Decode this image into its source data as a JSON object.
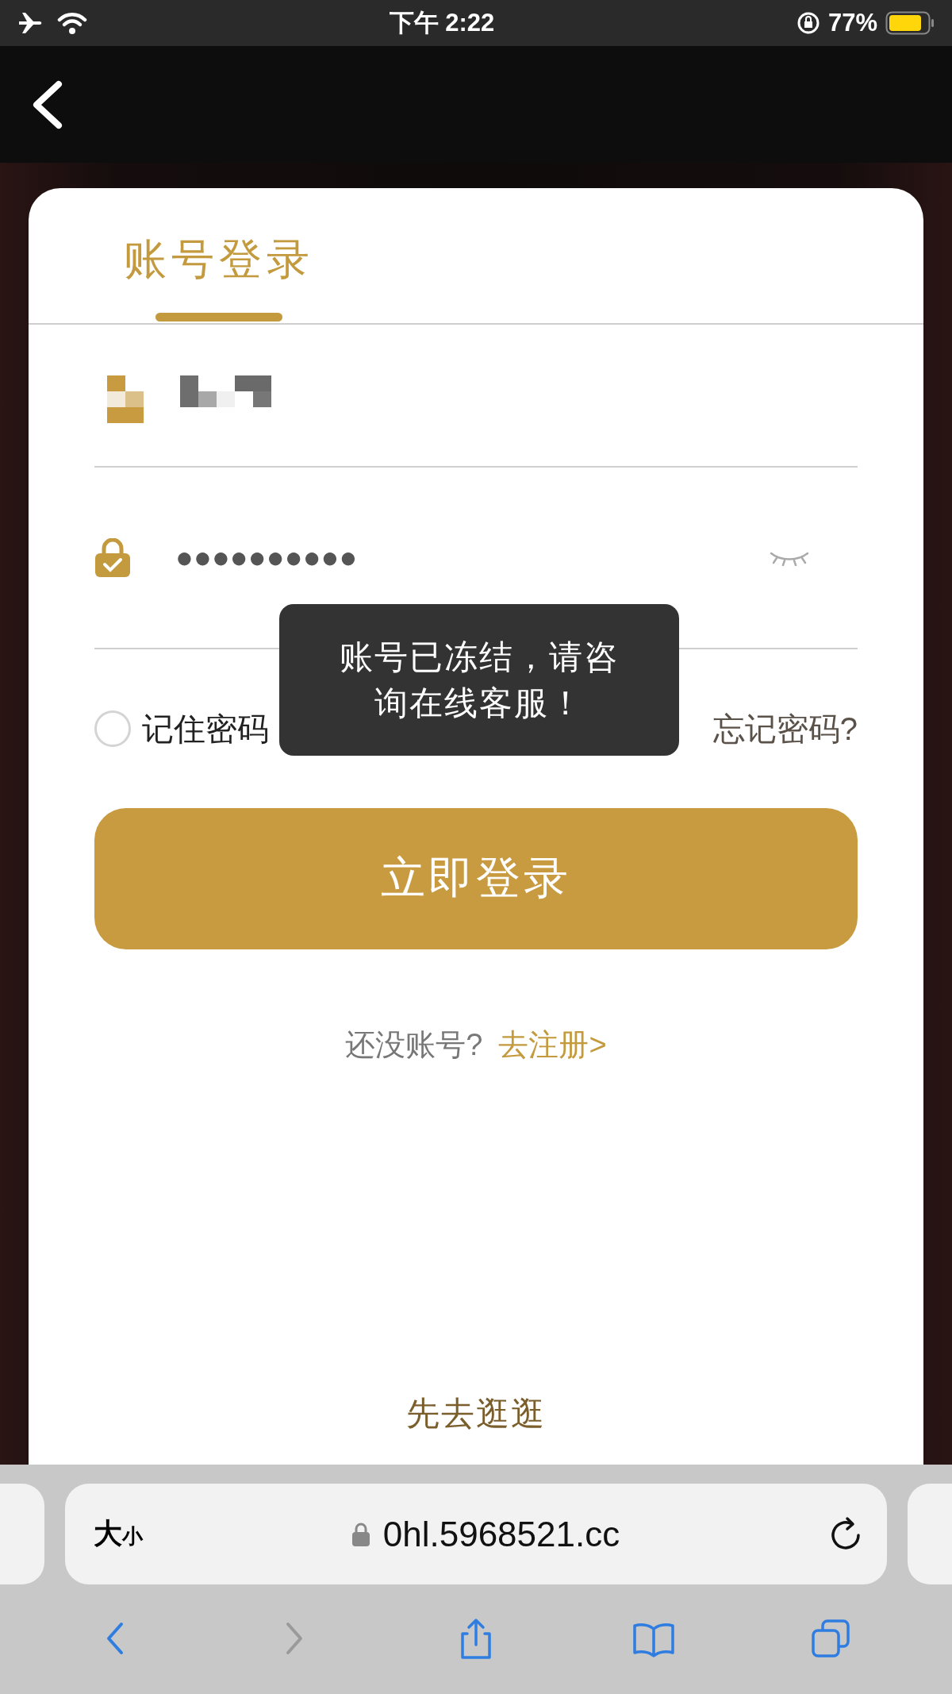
{
  "status_bar": {
    "time": "下午 2:22",
    "battery": "77%"
  },
  "tabs": [
    {
      "label": "账号登录",
      "selected": true
    }
  ],
  "password": {
    "value": "●●●●●●●●●●"
  },
  "remember": {
    "label": "记住密码",
    "checked": false
  },
  "forgot": "忘记密码?",
  "toast": "账号已冻结，请咨询在线客服！",
  "login_button": "立即登录",
  "register": {
    "prompt": "还没账号?",
    "link": "去注册>"
  },
  "browse": "先去逛逛",
  "browser": {
    "text_size_large": "大",
    "text_size_small": "小",
    "url": "0hl.5968521.cc"
  },
  "toolbar": [
    {
      "kind": "back",
      "disabled": false
    },
    {
      "kind": "forward",
      "disabled": true
    },
    {
      "kind": "share",
      "disabled": false
    },
    {
      "kind": "bookmarks",
      "disabled": false
    },
    {
      "kind": "tabs",
      "disabled": false
    }
  ]
}
